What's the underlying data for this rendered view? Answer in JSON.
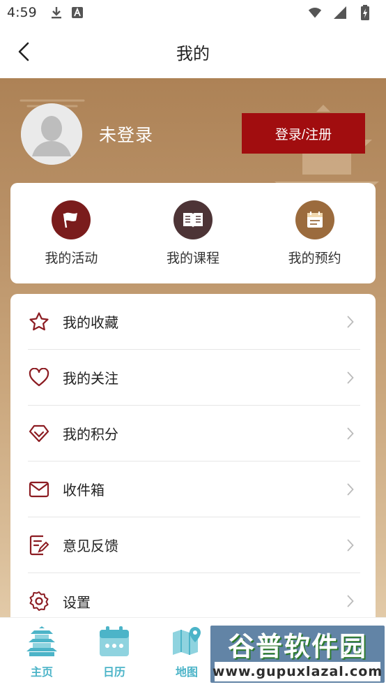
{
  "status_bar": {
    "time": "4:59",
    "icons": [
      "download-icon",
      "app-notification-icon",
      "wifi-icon",
      "signal-icon",
      "battery-icon"
    ]
  },
  "header": {
    "title": "我的",
    "back_icon": "chevron-left-icon"
  },
  "profile": {
    "username": "未登录",
    "login_button": "登录/注册",
    "avatar_icon": "default-avatar-icon"
  },
  "quick_actions": [
    {
      "label": "我的活动",
      "icon": "flag-icon",
      "color": "#7a1c1c"
    },
    {
      "label": "我的课程",
      "icon": "book-icon",
      "color": "#4d3436"
    },
    {
      "label": "我的预约",
      "icon": "calendar-note-icon",
      "color": "#9b6b3d"
    }
  ],
  "menu": [
    {
      "label": "我的收藏",
      "icon": "star-icon"
    },
    {
      "label": "我的关注",
      "icon": "heart-icon"
    },
    {
      "label": "我的积分",
      "icon": "diamond-icon"
    },
    {
      "label": "收件箱",
      "icon": "mail-icon"
    },
    {
      "label": "意见反馈",
      "icon": "feedback-icon"
    },
    {
      "label": "设置",
      "icon": "gear-icon"
    }
  ],
  "bottom_nav": [
    {
      "label": "主页",
      "icon": "pavilion-icon"
    },
    {
      "label": "日历",
      "icon": "calendar-icon"
    },
    {
      "label": "地图",
      "icon": "map-icon"
    }
  ],
  "watermark": {
    "title": "谷普软件园",
    "url": "www.gupuxlazal.com"
  },
  "colors": {
    "accent": "#a10d0f",
    "icon_red": "#8c1c22",
    "nav_teal": "#4cb4c8",
    "hero_top": "#ad8256"
  }
}
